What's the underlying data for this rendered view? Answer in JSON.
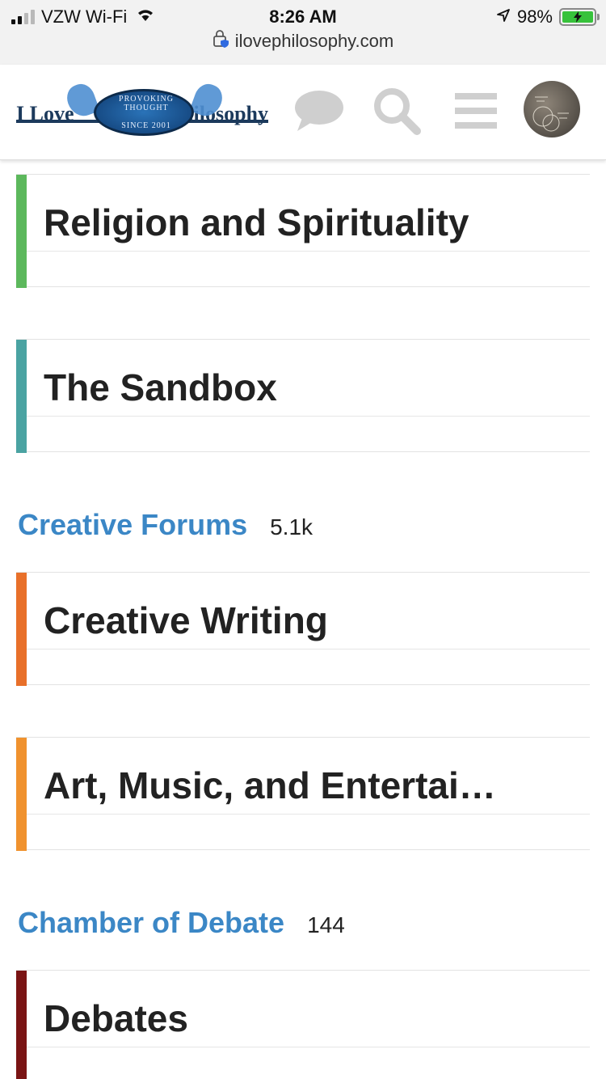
{
  "status_bar": {
    "carrier": "VZW Wi-Fi",
    "time": "8:26 AM",
    "battery_percent": "98%",
    "url": "ilovephilosophy.com"
  },
  "header": {
    "logo_left_text": "I Love",
    "logo_right_text": "Philosophy",
    "logo_ring_top": "PROVOKING THOUGHT",
    "logo_ring_bottom": "SINCE 2001",
    "icons": [
      "chat-icon",
      "search-icon",
      "menu-icon",
      "avatar"
    ]
  },
  "forums": [
    {
      "title": "Religion and Spirituality",
      "accent": "#5cb85c"
    },
    {
      "title": "The Sandbox",
      "accent": "#4aa3a2"
    }
  ],
  "categories": [
    {
      "name": "Creative Forums",
      "count": "5.1k",
      "forums": [
        {
          "title": "Creative Writing",
          "accent": "#e8702a"
        },
        {
          "title": "Art, Music, and Entertai…",
          "accent": "#f0922e"
        }
      ]
    },
    {
      "name": "Chamber of Debate",
      "count": "144",
      "forums": [
        {
          "title": "Debates",
          "accent": "#7a1414"
        }
      ]
    }
  ]
}
